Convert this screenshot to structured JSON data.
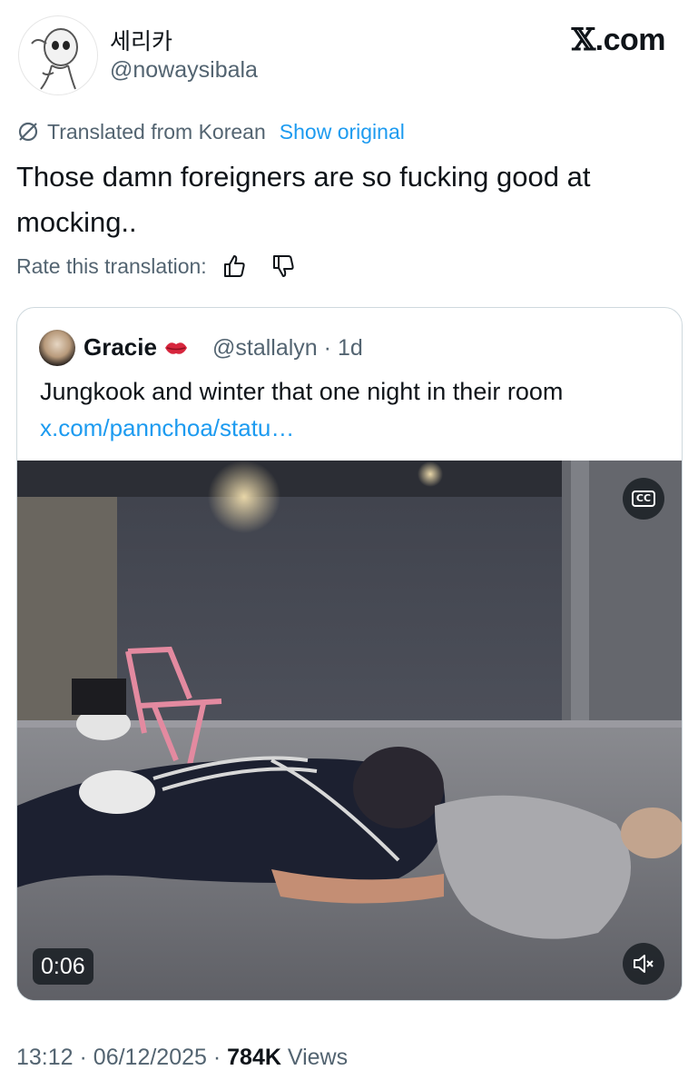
{
  "author": {
    "display_name": "세리카",
    "handle": "@nowaysibala",
    "avatar_icon": "cartoon-character-avatar"
  },
  "brand": {
    "logo_glyph": "𝕏",
    "logo_suffix": ".com"
  },
  "translation": {
    "notice": "Translated from Korean",
    "show_original": "Show original",
    "rate_label": "Rate this translation:"
  },
  "tweet": {
    "text": "Those damn foreigners are so fucking good at mocking.."
  },
  "quote": {
    "display_name": "Gracie",
    "handle": "@stallalyn",
    "separator": "·",
    "age": "1d",
    "text": "Jungkook and winter that one night in their room",
    "link": "x.com/pannchoa/statu…",
    "video": {
      "duration": "0:06",
      "cc_label": "CC"
    }
  },
  "footer": {
    "time": "13:12",
    "dot": "·",
    "date": "06/12/2025",
    "views_count": "784K",
    "views_label": "Views"
  },
  "colors": {
    "text_primary": "#0f1419",
    "text_secondary": "#536471",
    "link_blue": "#1d9bf0",
    "border": "#cfd9de"
  }
}
